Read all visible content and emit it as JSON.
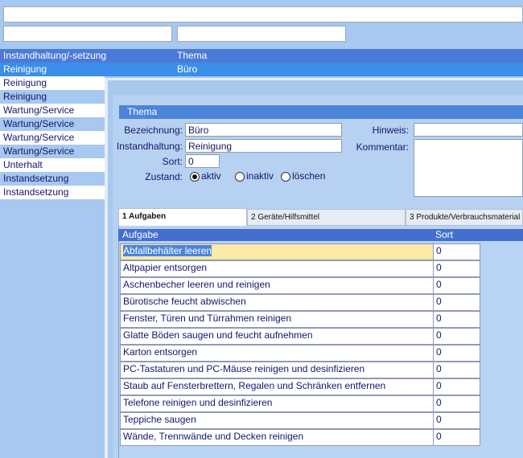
{
  "top": {
    "search_value": "",
    "filter1_value": "",
    "filter2_value": ""
  },
  "list": {
    "headers": [
      "Instandhaltung/-setzung",
      "Thema"
    ],
    "selected": {
      "col1": "Reinigung",
      "col2": "Büro"
    },
    "rows": [
      "Reinigung",
      "Reinigung",
      "Wartung/Service",
      "Wartung/Service",
      "Wartung/Service",
      "Wartung/Service",
      "Unterhalt",
      "Instandsetzung",
      "Instandsetzung"
    ]
  },
  "panel": {
    "title": "Thema",
    "bezeichnung_label": "Bezeichnung:",
    "bezeichnung_value": "Büro",
    "instandhaltung_label": "Instandhaltung:",
    "instandhaltung_value": "Reinigung",
    "sort_label": "Sort:",
    "sort_value": "0",
    "zustand_label": "Zustand:",
    "zustand_options": [
      "aktiv",
      "inaktiv",
      "löschen"
    ],
    "zustand_selected": "aktiv",
    "hinweis_label": "Hinweis:",
    "hinweis_value": "",
    "kommentar_label": "Kommentar:",
    "kommentar_value": ""
  },
  "tabs": [
    "1 Aufgaben",
    "2 Geräte/Hilfsmittel",
    "3 Produkte/Verbrauchsmaterial"
  ],
  "active_tab": "1 Aufgaben",
  "tasks": {
    "headers": {
      "task": "Aufgabe",
      "sort": "Sort"
    },
    "rows": [
      {
        "task": "Abfallbehälter leeren",
        "sort": "0"
      },
      {
        "task": "Altpapier entsorgen",
        "sort": "0"
      },
      {
        "task": "Aschenbecher leeren und reinigen",
        "sort": "0"
      },
      {
        "task": "Bürotische feucht abwischen",
        "sort": "0"
      },
      {
        "task": "Fenster, Türen und Türrahmen reinigen",
        "sort": "0"
      },
      {
        "task": "Glatte Böden saugen und feucht aufnehmen",
        "sort": "0"
      },
      {
        "task": "Karton entsorgen",
        "sort": "0"
      },
      {
        "task": "PC-Tastaturen und PC-Mäuse reinigen und desinfizieren",
        "sort": "0"
      },
      {
        "task": "Staub auf Fensterbrettern, Regalen und Schränken entfernen",
        "sort": "0"
      },
      {
        "task": "Telefone reinigen und desinfizieren",
        "sort": "0"
      },
      {
        "task": "Teppiche saugen",
        "sort": "0"
      },
      {
        "task": "Wände, Trennwände und Decken reinigen",
        "sort": "0"
      }
    ]
  },
  "colors": {
    "header_blue": "#4c7ad8",
    "selected_blue": "#3b8eea",
    "background": "#a7c8ef",
    "highlight": "#fbe9a6"
  }
}
